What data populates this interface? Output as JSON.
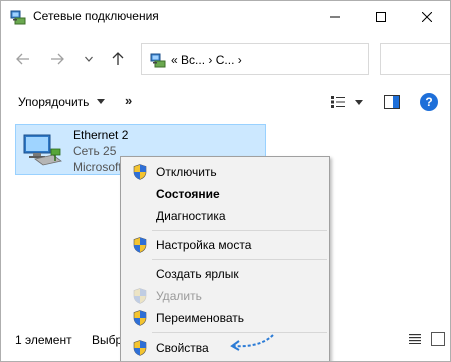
{
  "window": {
    "title": "Сетевые подключения"
  },
  "address": {
    "prefix": "«",
    "crumb1": "Вс...",
    "sep1": "›",
    "crumb2": "С...",
    "sep2": "›"
  },
  "command_bar": {
    "organize_label": "Упорядочить",
    "more": "»"
  },
  "connection": {
    "name": "Ethernet 2",
    "network": "Сеть 25",
    "adapter": "Microsoft"
  },
  "status": {
    "count": "1 элемент",
    "selected": "Выбр"
  },
  "context_menu": {
    "items": [
      {
        "label": "Отключить",
        "shield": true,
        "bold": false,
        "disabled": false
      },
      {
        "label": "Состояние",
        "shield": false,
        "bold": true,
        "disabled": false
      },
      {
        "label": "Диагностика",
        "shield": false,
        "bold": false,
        "disabled": false
      },
      {
        "label": "Настройка моста",
        "shield": true,
        "bold": false,
        "disabled": false
      },
      {
        "label": "Создать ярлык",
        "shield": false,
        "bold": false,
        "disabled": false
      },
      {
        "label": "Удалить",
        "shield": true,
        "bold": false,
        "disabled": true
      },
      {
        "label": "Переименовать",
        "shield": true,
        "bold": false,
        "disabled": false
      },
      {
        "label": "Свойства",
        "shield": true,
        "bold": false,
        "disabled": false
      }
    ]
  },
  "colors": {
    "selection": "#cce8ff",
    "selection_border": "#99d1ff",
    "accent": "#1e6fd9",
    "menu_bg": "#f2f2f2",
    "annotation": "#2b7bd6"
  },
  "icons": {
    "title": "network-connections-icon",
    "back": "arrow-left-icon",
    "forward": "arrow-right-icon",
    "up": "arrow-up-icon",
    "help": "help-icon",
    "shield": "uac-shield-icon"
  }
}
